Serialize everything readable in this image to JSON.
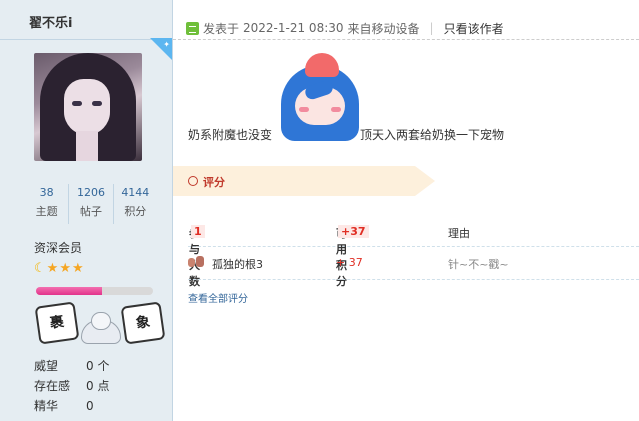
{
  "user": {
    "name": "翟不乐i",
    "stats": [
      {
        "value": "38",
        "label": "主题"
      },
      {
        "value": "1206",
        "label": "帖子"
      },
      {
        "value": "4144",
        "label": "积分"
      }
    ],
    "group": "资深会员",
    "level_progress_percent": 56,
    "medals": [
      "裹",
      "象"
    ],
    "info": [
      {
        "label": "威望",
        "value": "0 个"
      },
      {
        "label": "存在感",
        "value": "0 点"
      },
      {
        "label": "精华",
        "value": "0"
      }
    ]
  },
  "post": {
    "posted_prefix": "发表于",
    "date": "2022-1-21 08:30",
    "source": "来自移动设备",
    "only_author": "只看该作者",
    "text_before": "奶系附魔也没变",
    "text_after": "顶天入两套给奶换一下宠物"
  },
  "rating": {
    "label": "评分",
    "col_participants": "参与人数",
    "participants": "1",
    "col_points": "可用积分",
    "points_total": "+37",
    "col_reason": "理由",
    "rows": [
      {
        "user": "孤独的根3",
        "points": "+ 37",
        "reason": "针~不~戳~"
      }
    ],
    "view_all": "查看全部评分"
  },
  "colors": {
    "sidebar_bg": "#e5edf2",
    "link": "#336699",
    "rating_red": "#e02e24",
    "rate_bar_bg": "#fdf0dc"
  }
}
